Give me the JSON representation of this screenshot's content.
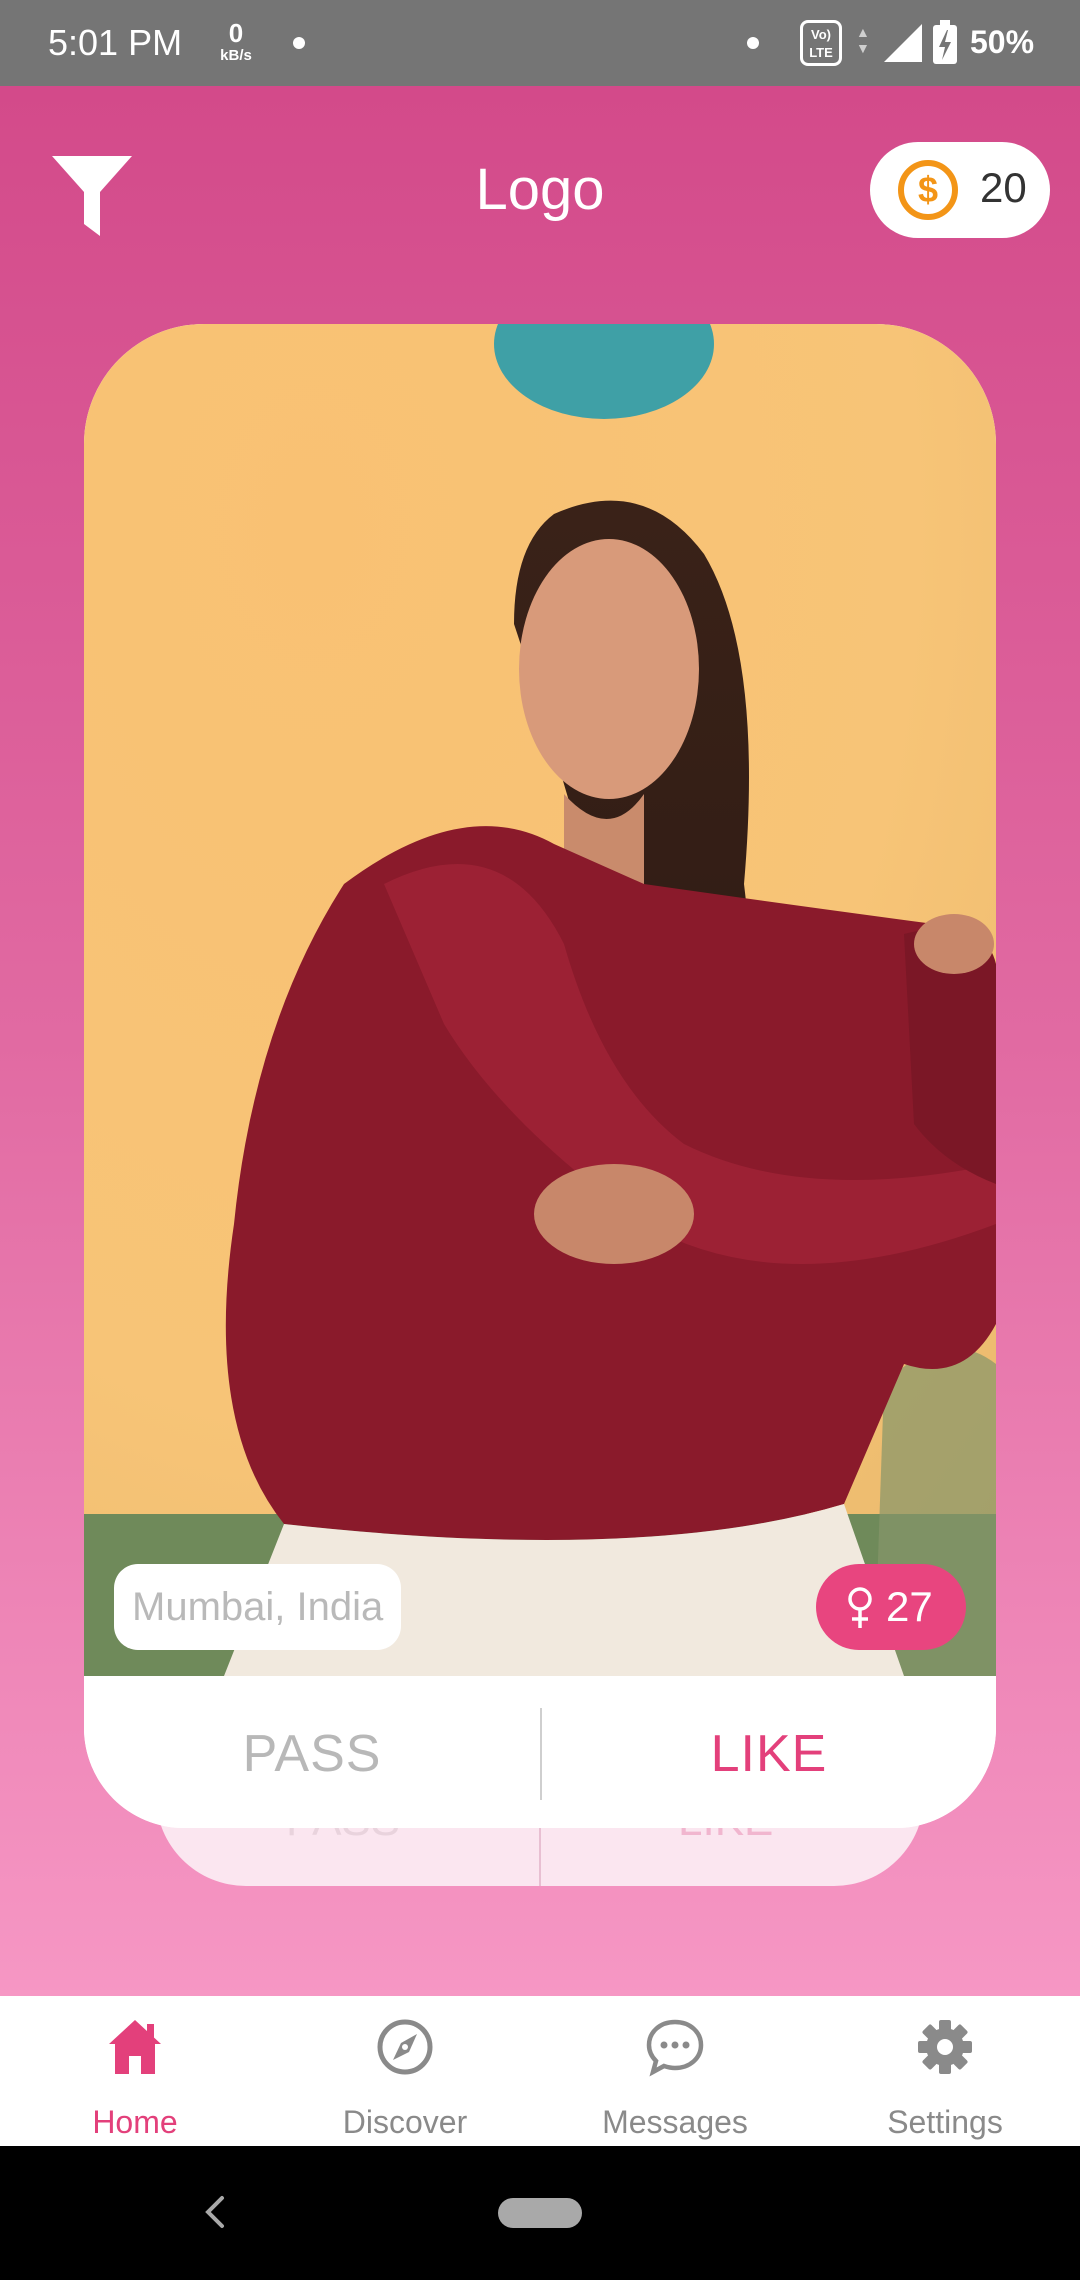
{
  "status_bar": {
    "time": "5:01 PM",
    "speed_value": "0",
    "speed_unit": "kB/s",
    "network_badge_top": "Vo)",
    "network_badge_bottom": "LTE",
    "battery": "50%"
  },
  "header": {
    "title": "Logo",
    "coins": "20",
    "coin_symbol": "$",
    "filter_icon": "filter-icon"
  },
  "profile_card": {
    "location": "Mumbai, India",
    "age": "27",
    "gender_icon": "female-icon",
    "pass_label": "PASS",
    "like_label": "LIKE"
  },
  "next_card": {
    "pass_label": "PASS",
    "like_label": "LIKE"
  },
  "bottom_nav": {
    "items": [
      {
        "label": "Home",
        "icon": "home-icon",
        "active": true
      },
      {
        "label": "Discover",
        "icon": "compass-icon",
        "active": false
      },
      {
        "label": "Messages",
        "icon": "chat-bubble-icon",
        "active": false
      },
      {
        "label": "Settings",
        "icon": "gear-icon",
        "active": false
      }
    ]
  },
  "colors": {
    "accent": "#e3407b",
    "background_top": "#d34a8a",
    "background_bottom": "#f697c4",
    "coin": "#f39517"
  }
}
